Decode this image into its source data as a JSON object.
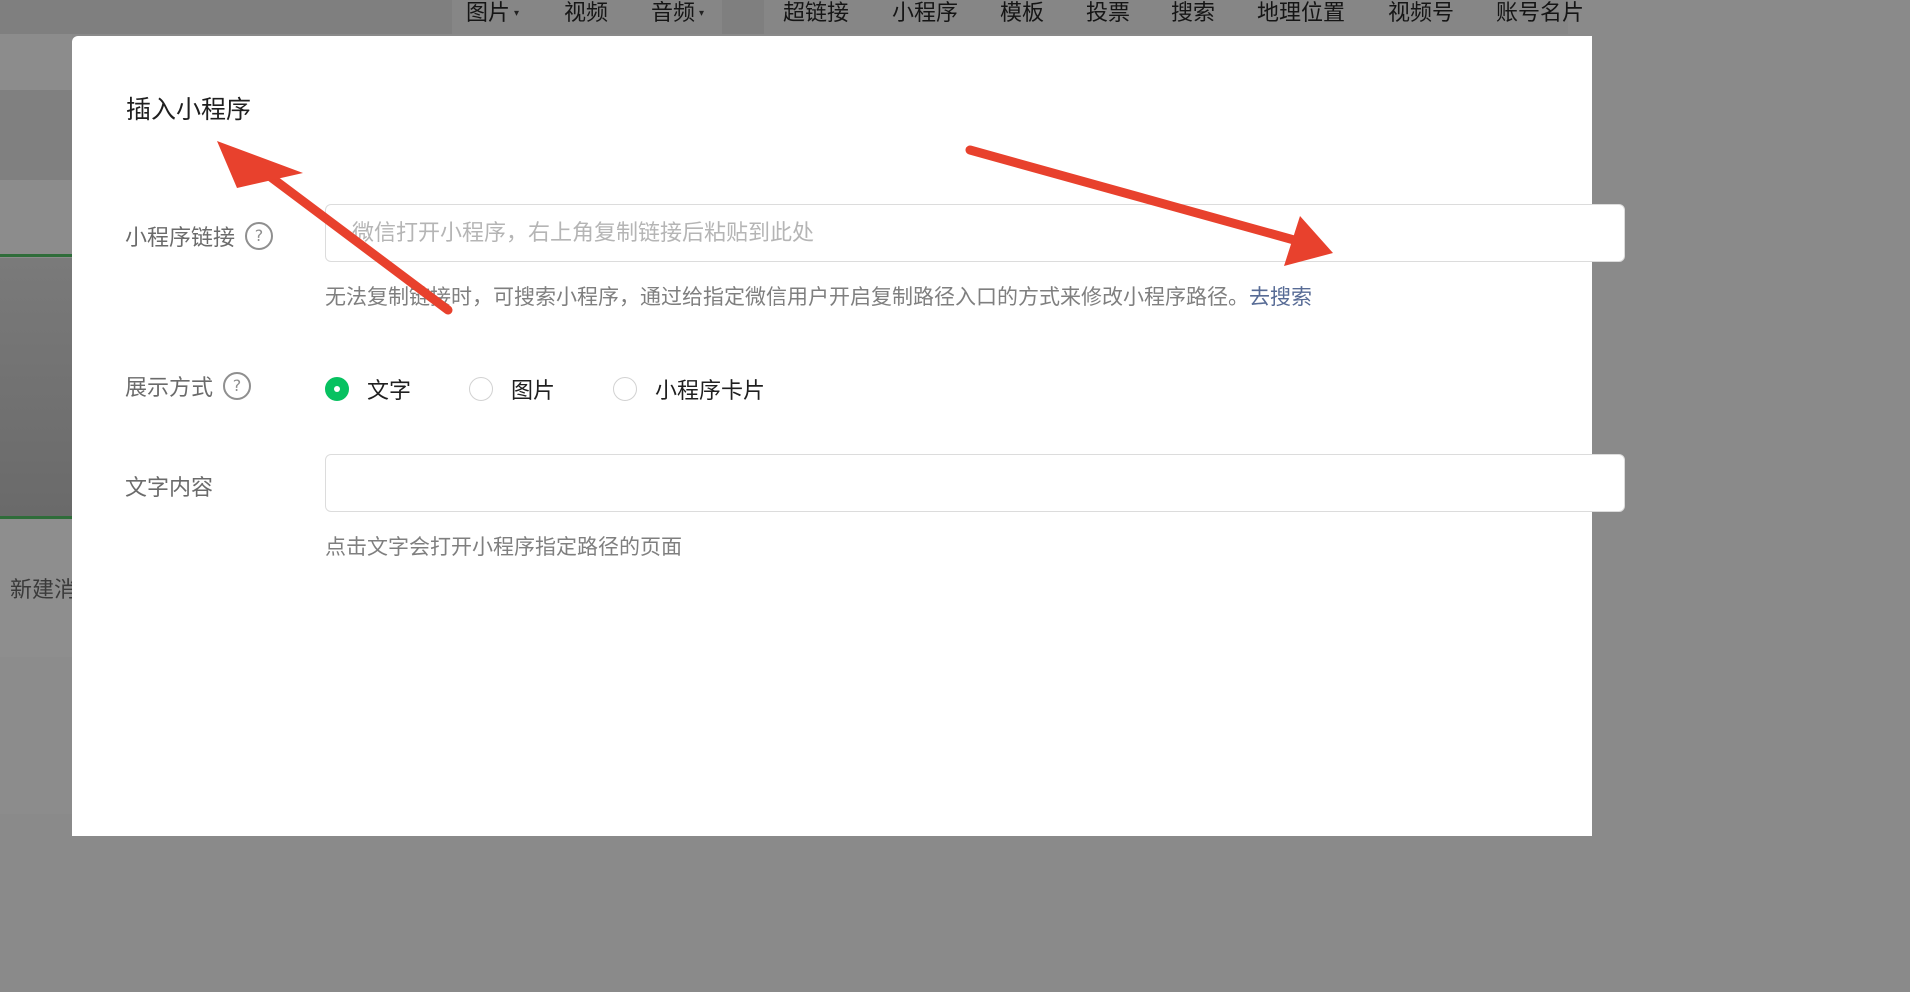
{
  "toolbar": {
    "items": [
      {
        "label": "图片",
        "dropdown": true
      },
      {
        "label": "视频",
        "dropdown": false
      },
      {
        "label": "音频",
        "dropdown": true
      },
      {
        "label": "超链接",
        "dropdown": false
      },
      {
        "label": "小程序",
        "dropdown": false
      },
      {
        "label": "模板",
        "dropdown": false
      },
      {
        "label": "投票",
        "dropdown": false
      },
      {
        "label": "搜索",
        "dropdown": false
      },
      {
        "label": "地理位置",
        "dropdown": false
      },
      {
        "label": "视频号",
        "dropdown": false
      },
      {
        "label": "账号名片",
        "dropdown": false
      }
    ],
    "caret_glyph": "▾"
  },
  "background": {
    "new_message_label": "新建消息"
  },
  "modal": {
    "title": "插入小程序",
    "link_field": {
      "label": "小程序链接",
      "help_glyph": "?",
      "placeholder": "微信打开小程序，右上角复制链接后粘贴到此处",
      "value": "",
      "hint": "无法复制链接时，可搜索小程序，通过给指定微信用户开启复制路径入口的方式来修改小程序路径。",
      "hint_link": "去搜索"
    },
    "display_mode": {
      "label": "展示方式",
      "help_glyph": "?",
      "options": [
        {
          "label": "文字",
          "checked": true
        },
        {
          "label": "图片",
          "checked": false
        },
        {
          "label": "小程序卡片",
          "checked": false
        }
      ]
    },
    "text_content": {
      "label": "文字内容",
      "value": "",
      "hint": "点击文字会打开小程序指定路径的页面"
    }
  },
  "colors": {
    "accent_green": "#07c160",
    "link_blue": "#576b95",
    "annotation_arrow": "#e8412d"
  }
}
